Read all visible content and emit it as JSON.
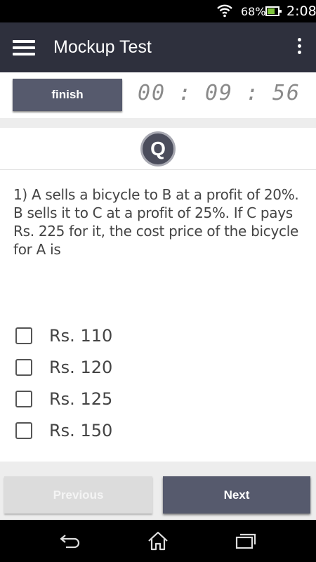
{
  "status_bar": {
    "battery_percent": "68%",
    "battery_level": 0.68,
    "time": "2:08",
    "icons": [
      "wifi-icon",
      "battery-icon"
    ],
    "battery_color": "#7ec33b"
  },
  "app_bar": {
    "title": "Mockup Test",
    "background": "#2e303d",
    "icons": [
      "hamburger-menu-icon",
      "overflow-menu-icon"
    ]
  },
  "timer": {
    "finish_label": "finish",
    "hours": "00",
    "minutes": "09",
    "seconds": "56",
    "separator": ":"
  },
  "question": {
    "badge": "Q",
    "text": "1) A sells a bicycle to B at a profit of 20%. B sells it to C at a profit of 25%. If C pays Rs. 225 for it, the cost price of the bicycle for A is",
    "options": [
      {
        "label": "Rs. 110",
        "checked": false
      },
      {
        "label": "Rs. 120",
        "checked": false
      },
      {
        "label": "Rs. 125",
        "checked": false
      },
      {
        "label": "Rs. 150",
        "checked": false
      }
    ]
  },
  "navigation": {
    "previous_label": "Previous",
    "previous_enabled": false,
    "next_label": "Next",
    "accent": "#565a6d"
  },
  "system_nav": {
    "icons": [
      "back-icon",
      "home-icon",
      "recents-icon"
    ]
  }
}
